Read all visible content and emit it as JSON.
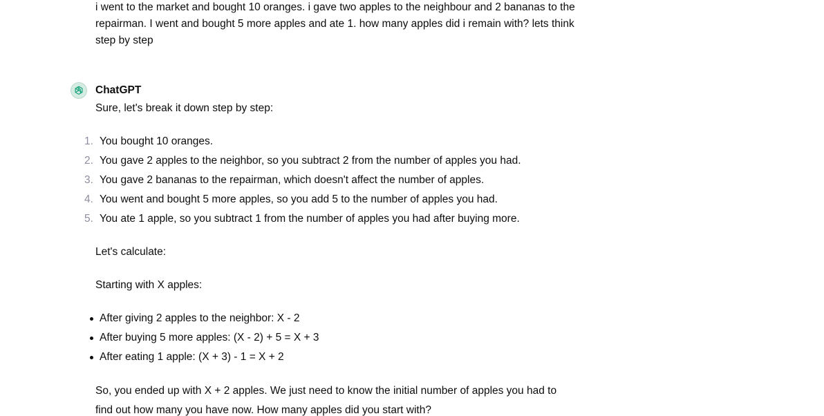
{
  "conversation": {
    "user_message": "i went to the market and bought 10 oranges. i gave two apples to the neighbour and 2 bananas to the repairman. I went and bought 5 more apples and ate 1. how many apples did i remain with? lets think step by step",
    "assistant": {
      "name": "ChatGPT",
      "avatar_icon": "openai-logo-icon",
      "intro": "Sure, let's break it down step by step:",
      "steps": [
        {
          "number": "1.",
          "text": "You bought 10 oranges."
        },
        {
          "number": "2.",
          "text": "You gave 2 apples to the neighbor, so you subtract 2 from the number of apples you had."
        },
        {
          "number": "3.",
          "text": "You gave 2 bananas to the repairman, which doesn't affect the number of apples."
        },
        {
          "number": "4.",
          "text": "You went and bought 5 more apples, so you add 5 to the number of apples you had."
        },
        {
          "number": "5.",
          "text": "You ate 1 apple, so you subtract 1 from the number of apples you had after buying more."
        }
      ],
      "calculate_label": "Let's calculate:",
      "starting_label": "Starting with X apples:",
      "bullets": [
        "After giving 2 apples to the neighbor: X - 2",
        "After buying 5 more apples: (X - 2) + 5 = X + 3",
        "After eating 1 apple: (X + 3) - 1 = X + 2"
      ],
      "conclusion": "So, you ended up with X + 2 apples. We just need to know the initial number of apples you had to find out how many you have now. How many apples did you start with?"
    }
  },
  "colors": {
    "text": "#0d0d0d",
    "list_number": "#8e8ea0",
    "avatar_stroke": "#19a37d"
  }
}
